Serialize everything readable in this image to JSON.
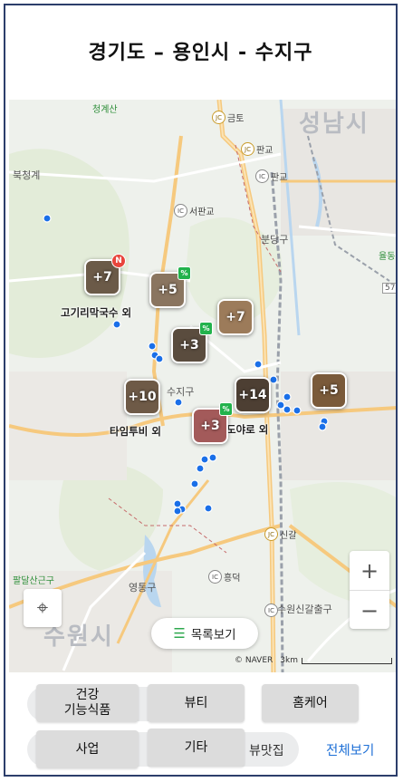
{
  "title": "경기도 – 용인시 - 수지구",
  "map": {
    "places": {
      "seongnam": "성남시",
      "suwon": "수원시",
      "cheonggye": "청계산",
      "bukcheonggye": "북청계",
      "seongbuk_sogak": "수지구",
      "bundang": "분당구",
      "yeongtong": "영통구",
      "paldal": "팔달산근구",
      "yullong": "율동",
      "suwonsingal": "수원신갈출구"
    },
    "ics": {
      "geumto": "금토",
      "pangyo_jc": "판교",
      "pangyo_ic": "판교",
      "seopangyo": "서판교",
      "singal": "신갈",
      "heungdeok": "흥덕"
    },
    "clusters": [
      {
        "count": "+7",
        "label": "고기리막국수 외",
        "badge": "N"
      },
      {
        "count": "+5",
        "badge": "%"
      },
      {
        "count": "+3",
        "badge": "%"
      },
      {
        "count": "+7"
      },
      {
        "count": "+10",
        "label": "타임투비 외"
      },
      {
        "count": "+14",
        "label": "도야로 외"
      },
      {
        "count": "+3",
        "badge": "%"
      },
      {
        "count": "+5"
      }
    ],
    "list_view": "목록보기",
    "naver": "© NAVER",
    "scale": "3km",
    "route_num": "57"
  },
  "categories": {
    "health": "건강\n기능식품",
    "beauty": "뷰티",
    "homecare": "홈케어",
    "business": "사업",
    "etc": "기타",
    "under_text": "뷰맛집",
    "view_all": "전체보기"
  },
  "colors": {
    "accent": "#1d6fd6",
    "badge_new": "#e8453c",
    "badge_pct": "#22b24c",
    "pin": "#1a6fe8"
  }
}
